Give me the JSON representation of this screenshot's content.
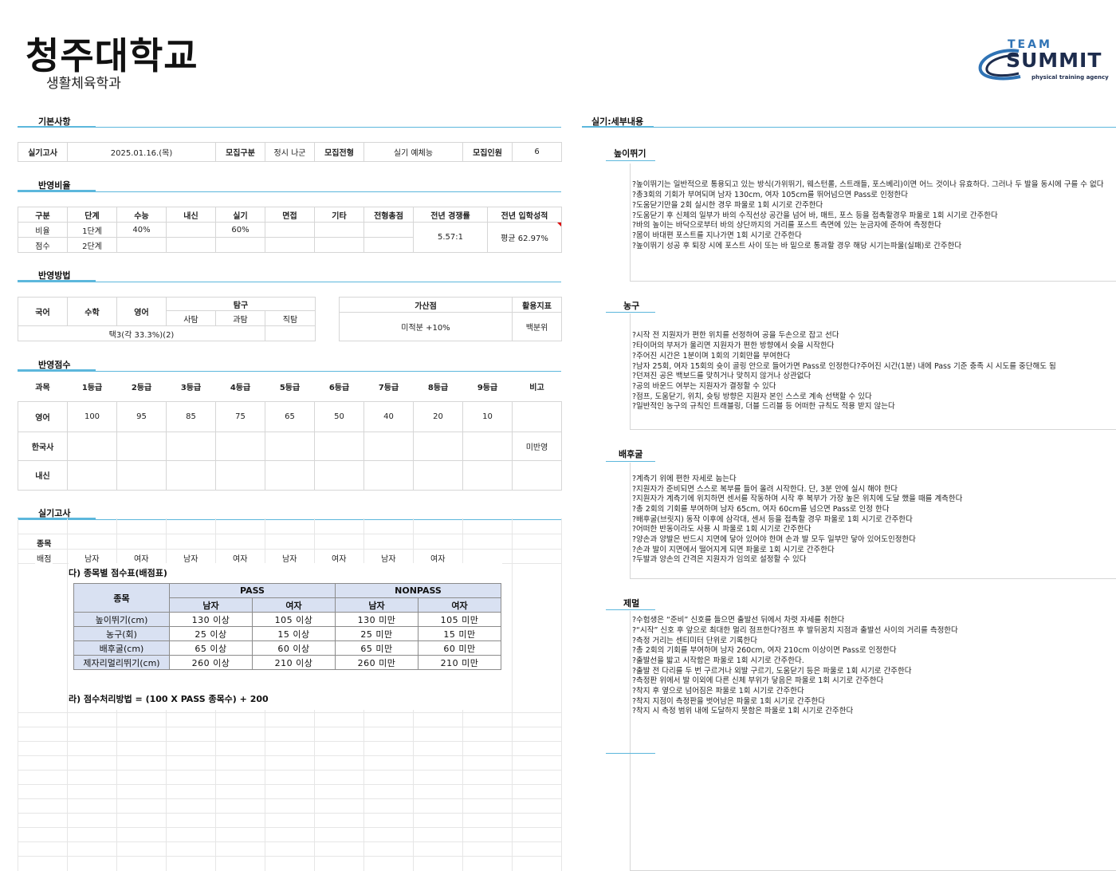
{
  "header": {
    "university": "청주대학교",
    "department": "생활체육학과",
    "logo": {
      "team": "TEAM",
      "summit": "SUMMIT",
      "subtitle": "physical training agency"
    }
  },
  "basic": {
    "title": "기본사항",
    "exam_label": "실기고사",
    "exam_date": "2025.01.16.(목)",
    "type_label": "모집구분",
    "type_value": "정시 나군",
    "screen_label": "모집전형",
    "screen_value": "실기 예체능",
    "count_label": "모집인원",
    "count_value": "6"
  },
  "ratio": {
    "title": "반영비율",
    "headers": [
      "구분",
      "단계",
      "수능",
      "내신",
      "실기",
      "면접",
      "기타",
      "전형총점",
      "전년 경쟁률",
      "전년 입학성적"
    ],
    "row1": {
      "label": "비율",
      "stage": "1단계",
      "suneung": "40%",
      "silgi": "60%"
    },
    "row2": {
      "label": "점수",
      "stage": "2단계"
    },
    "competition": "5.57:1",
    "prev_score": "평균 62.97%"
  },
  "method": {
    "title": "반영방법",
    "kor": "국어",
    "math": "수학",
    "eng": "영어",
    "tamgu": "탐구",
    "sub_social": "사탐",
    "sub_science": "과탐",
    "sub_job": "직탐",
    "choice": "택3(각 33.3%)(2)",
    "bonus_label": "가산점",
    "bonus_value": "미적분 +10%",
    "index_label": "활용지표",
    "index_value": "백분위"
  },
  "grade": {
    "title": "반영점수",
    "headers": [
      "과목",
      "1등급",
      "2등급",
      "3등급",
      "4등급",
      "5등급",
      "6등급",
      "7등급",
      "8등급",
      "9등급",
      "비고"
    ],
    "english_label": "영어",
    "english_scores": [
      "100",
      "95",
      "85",
      "75",
      "65",
      "50",
      "40",
      "20",
      "10"
    ],
    "history_label": "한국사",
    "history_note": "미반영",
    "naesin_label": "내신"
  },
  "practical": {
    "title": "실기고사",
    "event_label": "종목",
    "points_label": "배점",
    "genders": [
      "남자",
      "여자",
      "남자",
      "여자",
      "남자",
      "여자",
      "남자",
      "여자"
    ],
    "image_title": "다) 종목별 점수표(배점표)",
    "table_event": "종목",
    "table_pass": "PASS",
    "table_nonpass": "NONPASS",
    "table_male": "남자",
    "table_female": "여자",
    "rows": [
      {
        "event": "높이뛰기(cm)",
        "pm": "130 이상",
        "pf": "105 이상",
        "nm": "130 미만",
        "nf": "105 미만"
      },
      {
        "event": "농구(회)",
        "pm": "25 이상",
        "pf": "15 이상",
        "nm": "25 미만",
        "nf": "15 미만"
      },
      {
        "event": "배후굴(cm)",
        "pm": "65 이상",
        "pf": "60 이상",
        "nm": "65 미만",
        "nf": "60 미만"
      },
      {
        "event": "제자리멀리뛰기(cm)",
        "pm": "260 이상",
        "pf": "210 이상",
        "nm": "260 미만",
        "nf": "210 미만"
      }
    ],
    "formula": "라) 점수처리방법 = (100 X PASS 종목수) + 200"
  },
  "details": {
    "title": "실기:세부내용",
    "sections": [
      {
        "name": "높이뛰기",
        "lines": [
          "?높이뛰기는 일반적으로 통용되고 있는 방식(가위뛰기, 웨스턴롤, 스트래들, 포스베리)이면 어느 것이나 유효하다. 그러나 두 발을 동시에 구를 수 없다",
          "?총3회의 기회가 부여되며 남자 130cm, 여자 105cm를 뛰어넘으면 Pass로 인정한다",
          "?도움닫기만을 2회 실시한 경우 파울로 1회 시기로 간주한다",
          "?도움닫기 후 신체의 일부가 바의 수직선상 공간을 넘어 바, 매트, 포스 등을 접촉할경우 파울로 1회 시기로 간주한다",
          "?바의 높이는 바닥으로부터 바의 상단까지의 거리를 포스트 측면에 있는 눈금자에 준하여 측정한다",
          "?몸이 바대편 포스트를 지나가면 1회 시기로 간주한다",
          "?높이뛰기 성공 후 퇴장 시에 포스트 사이 또는 바 밑으로 통과할 경우 해당 시기는파울(실패)로 간주한다"
        ]
      },
      {
        "name": "농구",
        "lines": [
          "?시작 전 지원자가 편한 위치를 선정하여 공을 두손으로 잡고 선다",
          "?타이머의 부저가 울리면 지원자가 편한 방향에서 슛을 시작한다",
          "?주어진 시간은 1분이며 1회의 기회만을 부여한다",
          "?남자 25회, 여자 15회의 슛이 골링 안으로 들어가면 Pass로 인정한다?주어진 시간(1분) 내에 Pass 기준 충족 시 시도를 중단해도 됨",
          "?던져진 공은 백보드를 맞히거나 맞히지 않거나 상관없다",
          "?공의 바운드 여부는 지원자가 결정할 수 있다",
          "?점프, 도움닫기, 위치, 슛팅 방향은 지원자 본인 스스로 계속 선택할 수 있다",
          "?일반적인 농구의 규칙인 트래블링, 더블 드리블 등 어떠한 규칙도 적용 받지 않는다"
        ]
      },
      {
        "name": "배후굴",
        "lines": [
          "?계측기 위에 편한 자세로 눕는다",
          "?지원자가 준비되면 스스로 복부를 들어 올려 시작한다. 단, 3분 안에 실시 해야 한다",
          "?지원자가 계측기에 위치하면 센서를 작동하며 시작 후 복부가 가장 높은 위치에 도달 했을 때를 계측한다",
          "?총 2회의 기회를 부여하며 남자 65cm, 여자 60cm를 넘으면 Pass로 인정 한다",
          "?배후굴(브릿지) 동작 이후에 삼각대, 센서 등을 접촉할 경우 파울로 1회 시기로 간주한다",
          "?어떠한 반동이라도 사용 시 파울로 1회 시기로 간주한다",
          "?양손과 양발은 반드시 지면에 닿아 있어야 한며 손과 발 모두 일부만 닿아 있어도인정한다",
          "?손과 발이 지면에서 떨어지게 되면 파울로 1회 시기로 간주한다",
          "?두발과 양손의 간격은 지원자가 임의로 설정할 수 있다"
        ]
      },
      {
        "name": "제멀",
        "lines": [
          "?수험생은 “준비” 신호를 들으면 출발선 뒤에서 차렷 자세를 취한다",
          "?“시작” 신호 후 앞으로 최대한 멀리 점프한다?점프 후 발뒤꿈치 지점과 출발선 사이의 거리를 측정한다",
          "?측정 거리는 센티미터 단위로 기록한다",
          "?총 2회의 기회를 부여하며 남자 260cm, 여자 210cm 이상이면 Pass로 인정한다",
          "?출발선을 밟고 시작함은 파울로 1회 시기로 간주한다.",
          "?출발 전 다리를 두 번 구르거나 외발 구르기, 도움닫기 등은 파울로 1회 시기로 간주한다",
          "?측정판 위에서 발 이외에 다른 신체 부위가 닿음은 파울로 1회 시기로 간주한다",
          "?착지 후 옆으로 넘어짐은 파울로 1회 시기로 간주한다",
          "?착지 지점이 측정판을 벗어남은 파울로 1회 시기로 간주한다",
          "?착지 시 측정 범위 내에 도달하지 못함은 파울로 1회 시기로 간주한다"
        ]
      }
    ]
  }
}
